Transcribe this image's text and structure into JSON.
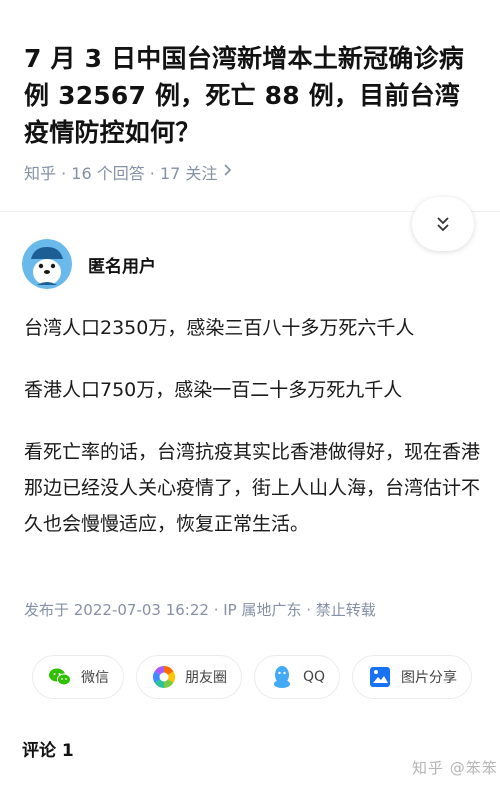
{
  "question": {
    "title": "7 月 3 日中国台湾新增本土新冠确诊病例 32567 例，死亡 88 例，目前台湾疫情防控如何？",
    "meta": "知乎 · 16 个回答 · 17 关注"
  },
  "author": {
    "name": "匿名用户"
  },
  "answer": {
    "paragraphs": [
      "台湾人口2350万，感染三百八十多万死六千人",
      "香港人口750万，感染一百二十多万死九千人",
      "看死亡率的话，台湾抗疫其实比香港做得好，现在香港那边已经没人关心疫情了，街上人山人海，台湾估计不久也会慢慢适应，恢复正常生活。"
    ],
    "footer": "发布于 2022-07-03 16:22 · IP 属地广东 · 禁止转载"
  },
  "share": {
    "wechat": "微信",
    "moments": "朋友圈",
    "qq": "QQ",
    "image": "图片分享"
  },
  "comments": {
    "title": "评论 1"
  },
  "watermark": "知乎 @笨笨",
  "icons": {
    "meta_chevron": "chevron-right-icon",
    "expand": "double-chevron-down-icon",
    "wechat": "wechat-icon",
    "moments": "moments-icon",
    "qq": "qq-icon",
    "image": "image-share-icon"
  },
  "colors": {
    "zhihu_blue": "#0066ff",
    "wechat_green": "#2dc100",
    "meta_gray": "#8590a6"
  }
}
